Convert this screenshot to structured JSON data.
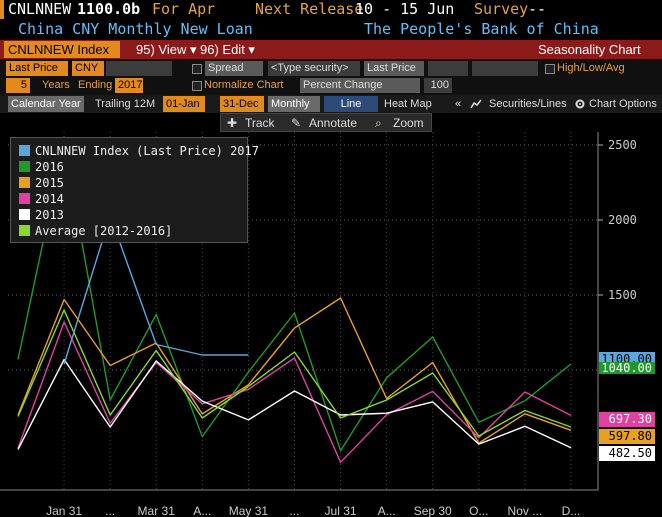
{
  "header": {
    "ticker": "CNLNNEW",
    "price": "1100.0b",
    "period": "For Apr",
    "next_release_label": "Next Release",
    "next_release": "10 - 15 Jun",
    "survey_label": "Survey",
    "survey_value": "--",
    "name": "China CNY Monthly New Loan",
    "source": "The People's Bank of China"
  },
  "toolbar": {
    "security": "CNLNNEW Index",
    "view_label": "95) View ▾",
    "edit_label": "96) Edit ▾",
    "chart_name": "Seasonality Chart"
  },
  "settings": {
    "field_label": "Last Price",
    "currency": "CNY",
    "spread_label": "Spread",
    "type_security": "<Type security>",
    "spread_field": "Last Price",
    "high_low_avg": "High/Low/Avg",
    "years_value": "5",
    "years_label": "Years",
    "ending_label": "Ending",
    "ending_value": "2017",
    "normalize_label": "Normalize Chart",
    "percent_change": "Percent Change",
    "base_value": "100"
  },
  "tabs": {
    "calendar_year": "Calendar Year",
    "trailing": "Trailing 12M",
    "start": "01-Jan",
    "end": "31-Dec",
    "monthly": "Monthly",
    "line": "Line",
    "heatmap": "Heat Map",
    "collapse": "«",
    "securities": "Securities/Lines",
    "chart_options": "Chart Options"
  },
  "tools": {
    "track": "Track",
    "annotate": "Annotate",
    "zoom": "Zoom"
  },
  "price_boxes": {
    "b2017": "1100.00",
    "b2016": "1040.00",
    "b2014": "697.30",
    "b2015": "597.80",
    "b2013": "482.50"
  },
  "chart_data": {
    "type": "line",
    "x_tick_labels": [
      "Jan 31",
      "...",
      "Mar 31",
      "A...",
      "May 31",
      "...",
      "Jul 31",
      "A...",
      "Sep 30",
      "O...",
      "Nov ...",
      "D..."
    ],
    "y_ticks": [
      1500,
      2000,
      2500
    ],
    "y_tick_labels": [
      "1500",
      "2000",
      "2500"
    ],
    "ylim": [
      0,
      2500
    ],
    "legend_placement": "top-left",
    "series": [
      {
        "name": "CNLNNEW Index (Last Price) 2017",
        "color": "#5aa7e0",
        "values": [
          1040,
          2030,
          1170,
          1100,
          1100
        ]
      },
      {
        "name": "2016",
        "color": "#1f9a2a",
        "values": [
          1070,
          2510,
          800,
          1370,
          556,
          986,
          1380,
          463,
          948,
          1220,
          651,
          795,
          1040
        ]
      },
      {
        "name": "2015",
        "color": "#e8a020",
        "values": [
          700,
          1470,
          1030,
          1180,
          707,
          901,
          1280,
          1480,
          810,
          1050,
          513,
          708,
          598
        ]
      },
      {
        "name": "2014",
        "color": "#e040a0",
        "values": [
          480,
          1320,
          645,
          1050,
          775,
          871,
          1080,
          385,
          702,
          857,
          548,
          853,
          697
        ]
      },
      {
        "name": "2013",
        "color": "#ffffff",
        "values": [
          470,
          1070,
          620,
          1060,
          793,
          667,
          860,
          700,
          712,
          787,
          506,
          625,
          482
        ]
      },
      {
        "name": "Average [2012-2016]",
        "color": "#8ad82a",
        "values": [
          690,
          1400,
          700,
          1130,
          680,
          890,
          1120,
          680,
          800,
          980,
          560,
          730,
          620
        ]
      }
    ]
  }
}
